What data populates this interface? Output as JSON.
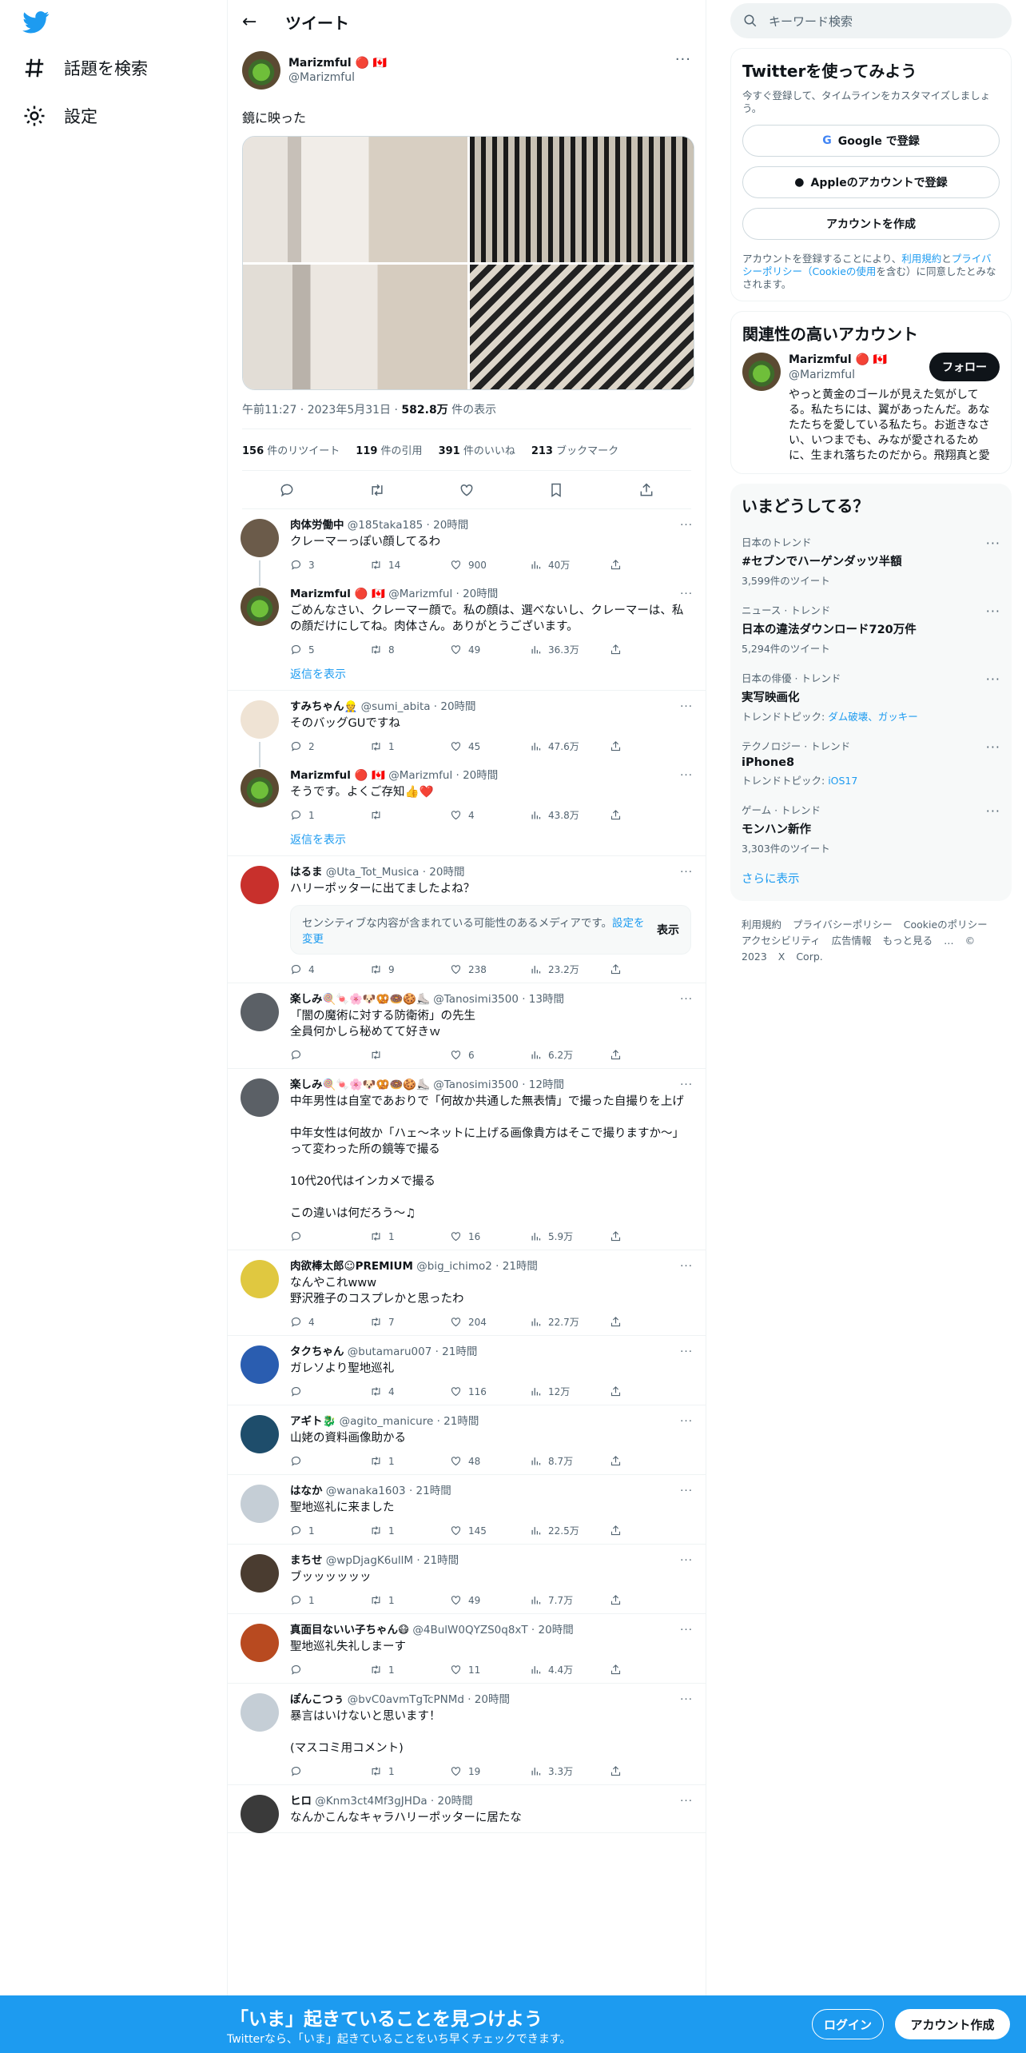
{
  "nav": {
    "explore": "話題を検索",
    "settings": "設定"
  },
  "header": {
    "title": "ツイート",
    "back": "←"
  },
  "main_tweet": {
    "name": "Marizmful 🔴 🇨🇦",
    "handle": "@Marizmful",
    "text": "鏡に映った",
    "time": "午前11:27 · 2023年5月31日 · ",
    "views": "582.8万",
    "views_label": " 件の表示",
    "retweets": "156",
    "retweets_label": " 件のリツイート",
    "quotes": "119",
    "quotes_label": " 件の引用",
    "likes": "391",
    "likes_label": " 件のいいね",
    "bookmarks": "213",
    "bookmarks_label": " ブックマーク"
  },
  "replies": [
    {
      "name": "肉体労働中",
      "handle": "@185taka185 · 20時間",
      "text": "クレーマーっぽい顔してるわ",
      "reply": "3",
      "rt": "14",
      "like": "900",
      "views": "40万"
    },
    {
      "name": "Marizmful 🔴 🇨🇦",
      "handle": "@Marizmful · 20時間",
      "text": "ごめんなさい、クレーマー顔で。私の顔は、選べないし、クレーマーは、私の顔だけにしてね。肉体さん。ありがとうございます。",
      "reply": "5",
      "rt": "8",
      "like": "49",
      "views": "36.3万"
    },
    {
      "name": "すみちゃん👷",
      "handle": "@sumi_abita · 20時間",
      "text": "そのバッグGUですね",
      "reply": "2",
      "rt": "1",
      "like": "45",
      "views": "47.6万"
    },
    {
      "name": "Marizmful 🔴 🇨🇦",
      "handle": "@Marizmful · 20時間",
      "text": "そうです。よくご存知👍❤️",
      "reply": "1",
      "rt": "",
      "like": "4",
      "views": "43.8万"
    },
    {
      "name": "はるま",
      "handle": "@Uta_Tot_Musica · 20時間",
      "text": "ハリーポッターに出てましたよね？",
      "reply": "4",
      "rt": "9",
      "like": "238",
      "views": "23.2万"
    },
    {
      "name": "楽しみ🍭🍬🌸🐶🥨🍩🍪⛸️",
      "handle": "@Tanosimi3500 · 13時間",
      "text": "「闇の魔術に対する防衛術」の先生\n全員何かしら秘めてて好きｗ",
      "reply": "",
      "rt": "",
      "like": "6",
      "views": "6.2万"
    },
    {
      "name": "楽しみ🍭🍬🌸🐶🥨🍩🍪⛸️",
      "handle": "@Tanosimi3500 · 12時間",
      "text": "中年男性は自室であおりで「何故か共通した無表情」で撮った自撮りを上げ\n\n中年女性は何故か「ハェ〜ネットに上げる画像貴方はそこで撮りますか〜」って変わった所の鏡等で撮る\n\n10代20代はインカメで撮る\n\nこの違いは何だろう〜♫",
      "reply": "",
      "rt": "1",
      "like": "16",
      "views": "5.9万"
    },
    {
      "name": "肉欲棒太郎☺PREMIUM",
      "handle": "@big_ichimo2 · 21時間",
      "text": "なんやこれwww\n野沢雅子のコスプレかと思ったわ",
      "reply": "4",
      "rt": "7",
      "like": "204",
      "views": "22.7万"
    },
    {
      "name": "タクちゃん",
      "handle": "@butamaru007 · 21時間",
      "text": "ガレソより聖地巡礼",
      "reply": "",
      "rt": "4",
      "like": "116",
      "views": "12万"
    },
    {
      "name": "アギト🐉",
      "handle": "@agito_manicure · 21時間",
      "text": "山姥の資料画像助かる",
      "reply": "",
      "rt": "1",
      "like": "48",
      "views": "8.7万"
    },
    {
      "name": "はなか",
      "handle": "@wanaka1603 · 21時間",
      "text": "聖地巡礼に来ました",
      "reply": "1",
      "rt": "1",
      "like": "145",
      "views": "22.5万"
    },
    {
      "name": "まちせ",
      "handle": "@wpDjagK6ullM · 21時間",
      "text": "ブッッッッッッ",
      "reply": "1",
      "rt": "1",
      "like": "49",
      "views": "7.7万"
    },
    {
      "name": "真面目ないい子ちゃん😷",
      "handle": "@4BulW0QYZS0q8xT · 20時間",
      "text": "聖地巡礼失礼しまーす",
      "reply": "",
      "rt": "1",
      "like": "11",
      "views": "4.4万"
    },
    {
      "name": "ぽんこつぅ",
      "handle": "@bvC0avmTgTcPNMd · 20時間",
      "text": "暴言はいけないと思います！\n\n(マスコミ用コメント)",
      "reply": "",
      "rt": "1",
      "like": "19",
      "views": "3.3万"
    },
    {
      "name": "ヒロ",
      "handle": "@Knm3ct4Mf3gJHDa · 20時間",
      "text": "なんかこんなキャラハリーポッターに居たな",
      "reply": "",
      "rt": "",
      "like": "",
      "views": ""
    }
  ],
  "show_replies": "返信を表示",
  "sensitive": {
    "text": "センシティブな内容が含まれている可能性のあるメディアです。",
    "link": "設定を変更",
    "button": "表示"
  },
  "right": {
    "search_placeholder": "キーワード検索",
    "signup": {
      "title": "Twitterを使ってみよう",
      "sub": "今すぐ登録して、タイムラインをカスタマイズしましょう。",
      "google": "Google で登録",
      "apple": "Appleのアカウントで登録",
      "create": "アカウントを作成",
      "legal1": "アカウントを登録することにより、",
      "legal_link1": "利用規約",
      "legal2": "と",
      "legal_link2": "プライバシーポリシー（Cookieの使用",
      "legal3": "を含む）に同意したとみなされます。"
    },
    "related": {
      "title": "関連性の高いアカウント",
      "name": "Marizmful 🔴 🇨🇦",
      "handle": "@Marizmful",
      "follow": "フォロー",
      "bio": "やっと黄金のゴールが見えた気がしてる。私たちには、翼があったんだ。あなたたちを愛している私たち。お逝きなさい、いつまでも、みなが愛されるために、生まれ落ちたのだから。飛翔真と愛"
    },
    "trends_title": "いまどうしてる？",
    "trends": [
      {
        "cat": "日本のトレンド",
        "name": "#セブンでハーゲンダッツ半額",
        "count": "3,599件のツイート",
        "topics": ""
      },
      {
        "cat": "ニュース · トレンド",
        "name": "日本の違法ダウンロード720万件",
        "count": "5,294件のツイート",
        "topics": ""
      },
      {
        "cat": "日本の俳優 · トレンド",
        "name": "実写映画化",
        "count": "トレンドトピック: ",
        "topics": "ダム破壊、ガッキー"
      },
      {
        "cat": "テクノロジー · トレンド",
        "name": "iPhone8",
        "count": "トレンドトピック: ",
        "topics": "iOS17"
      },
      {
        "cat": "ゲーム · トレンド",
        "name": "モンハン新作",
        "count": "3,303件のツイート",
        "topics": ""
      }
    ],
    "show_more": "さらに表示",
    "footer": [
      "利用規約",
      "プライバシーポリシー",
      "Cookieのポリシー",
      "アクセシビリティ",
      "広告情報",
      "もっと見る …",
      "© 2023 X Corp."
    ]
  },
  "bottom": {
    "title": "「いま」起きていることを見つけよう",
    "sub": "Twitterなら、「いま」起きていることをいち早くチェックできます。",
    "login": "ログイン",
    "signup": "アカウント作成"
  },
  "colors": {
    "accent": "#1d9bf0",
    "text": "#0f1419",
    "muted": "#536471"
  }
}
